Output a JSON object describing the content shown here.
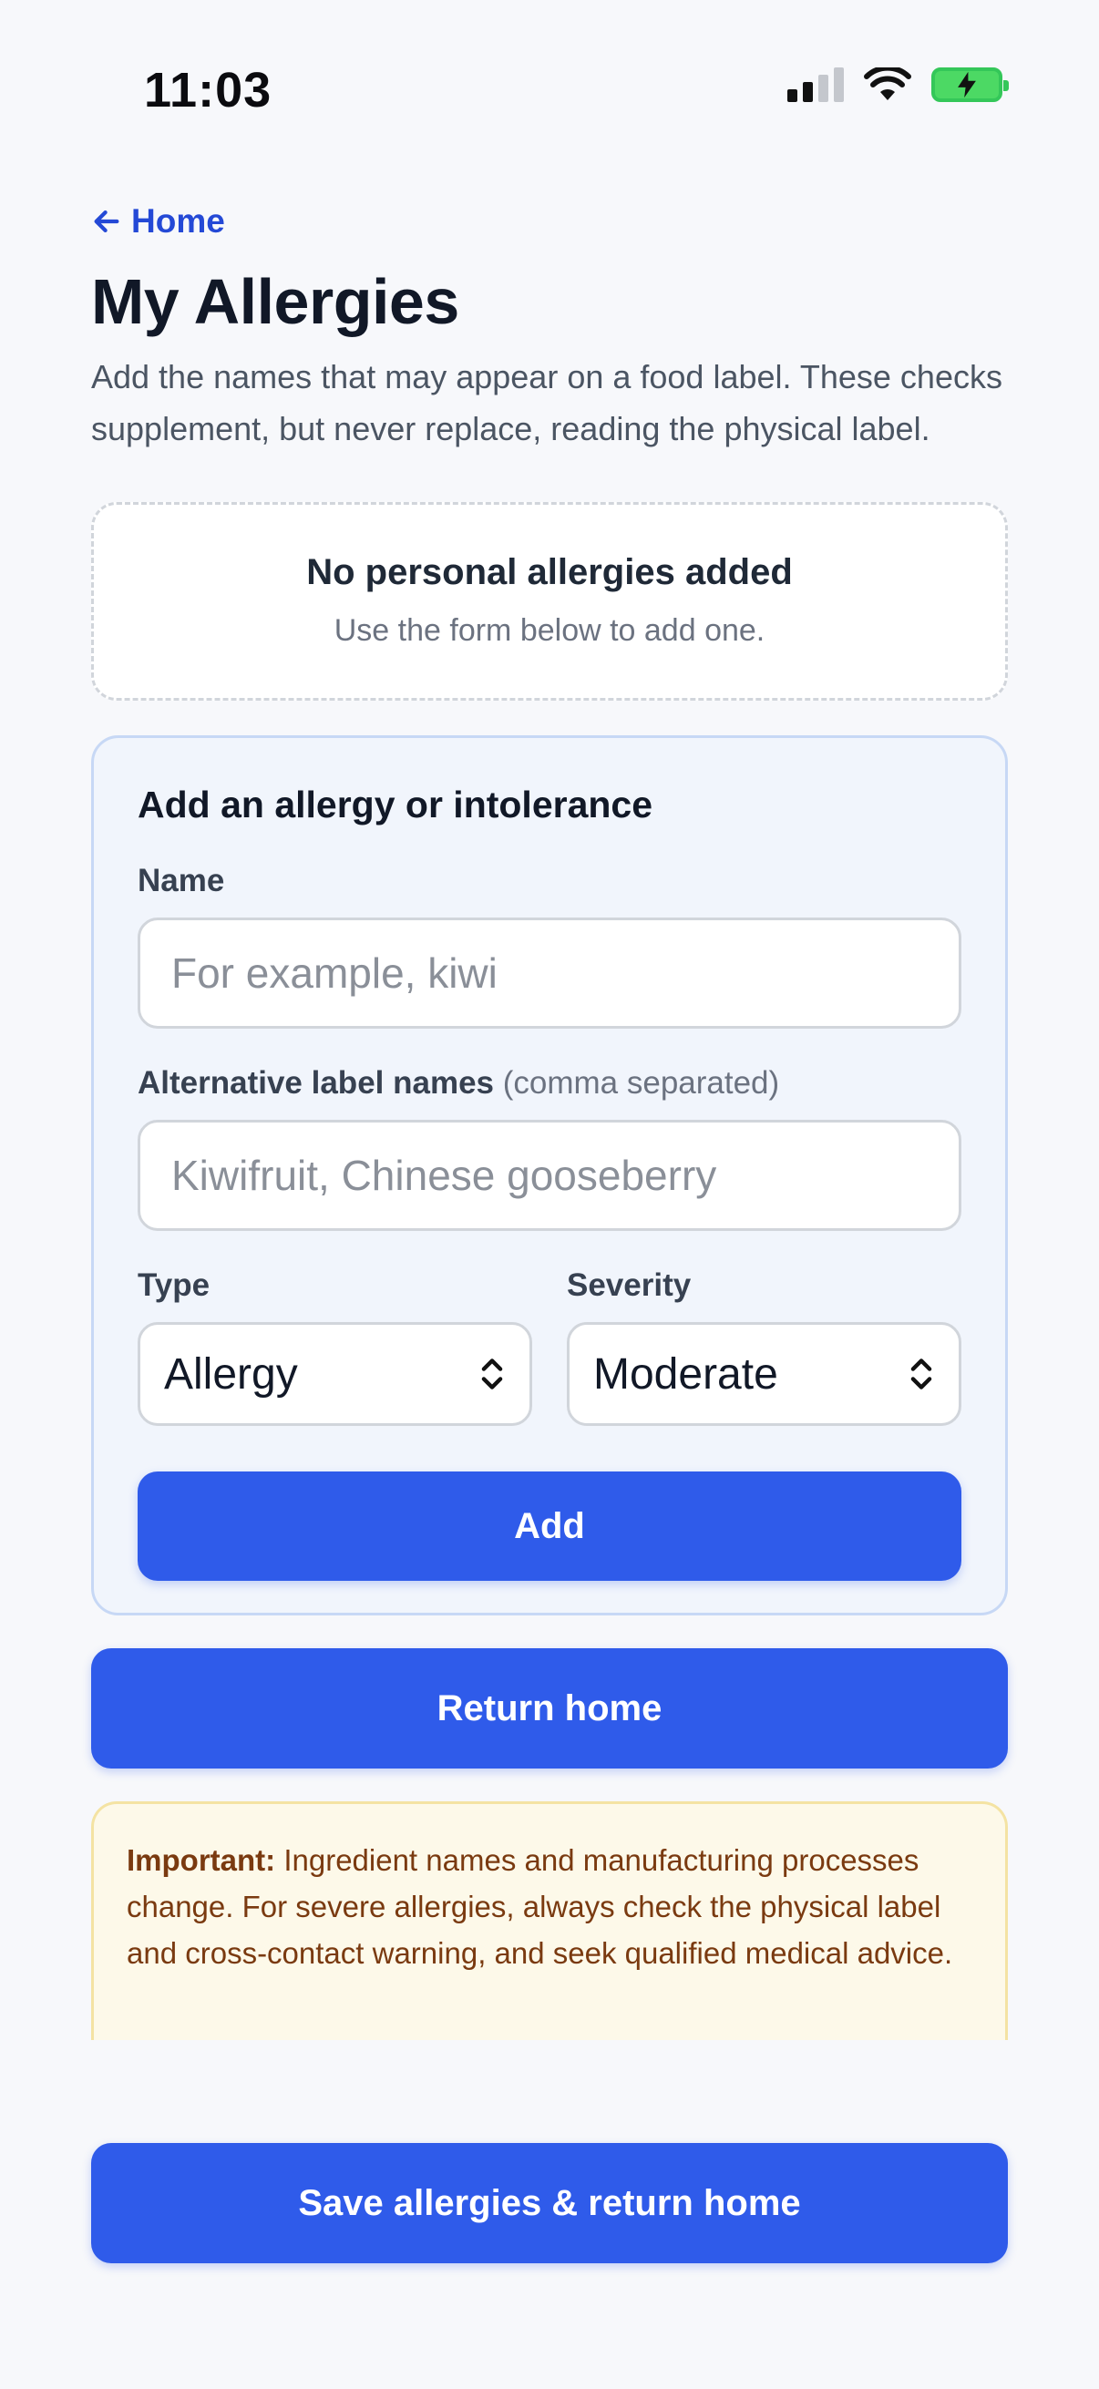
{
  "status_bar": {
    "time": "11:03"
  },
  "nav": {
    "back_label": "Home"
  },
  "page": {
    "title": "My Allergies",
    "intro": "Add the names that may appear on a food label. These checks supplement, but never replace, reading the physical label."
  },
  "empty_state": {
    "title": "No personal allergies added",
    "subtitle": "Use the form below to add one."
  },
  "form": {
    "title": "Add an allergy or intolerance",
    "name_label": "Name",
    "name_placeholder": "For example, kiwi",
    "alt_label": "Alternative label names",
    "alt_hint": "(comma separated)",
    "alt_placeholder": "Kiwifruit, Chinese gooseberry",
    "type_label": "Type",
    "type_value": "Allergy",
    "severity_label": "Severity",
    "severity_value": "Moderate",
    "add_label": "Add"
  },
  "actions": {
    "return_home": "Return home",
    "save": "Save allergies & return home"
  },
  "notice": {
    "label": "Important:",
    "text": " Ingredient names and manufacturing processes change. For severe allergies, always check the physical label and cross-contact warning, and seek qualified medical advice."
  },
  "colors": {
    "primary": "#2f5bea",
    "link": "#2449d6",
    "notice_bg": "#fdf9e9",
    "notice_text": "#7a3a10"
  }
}
